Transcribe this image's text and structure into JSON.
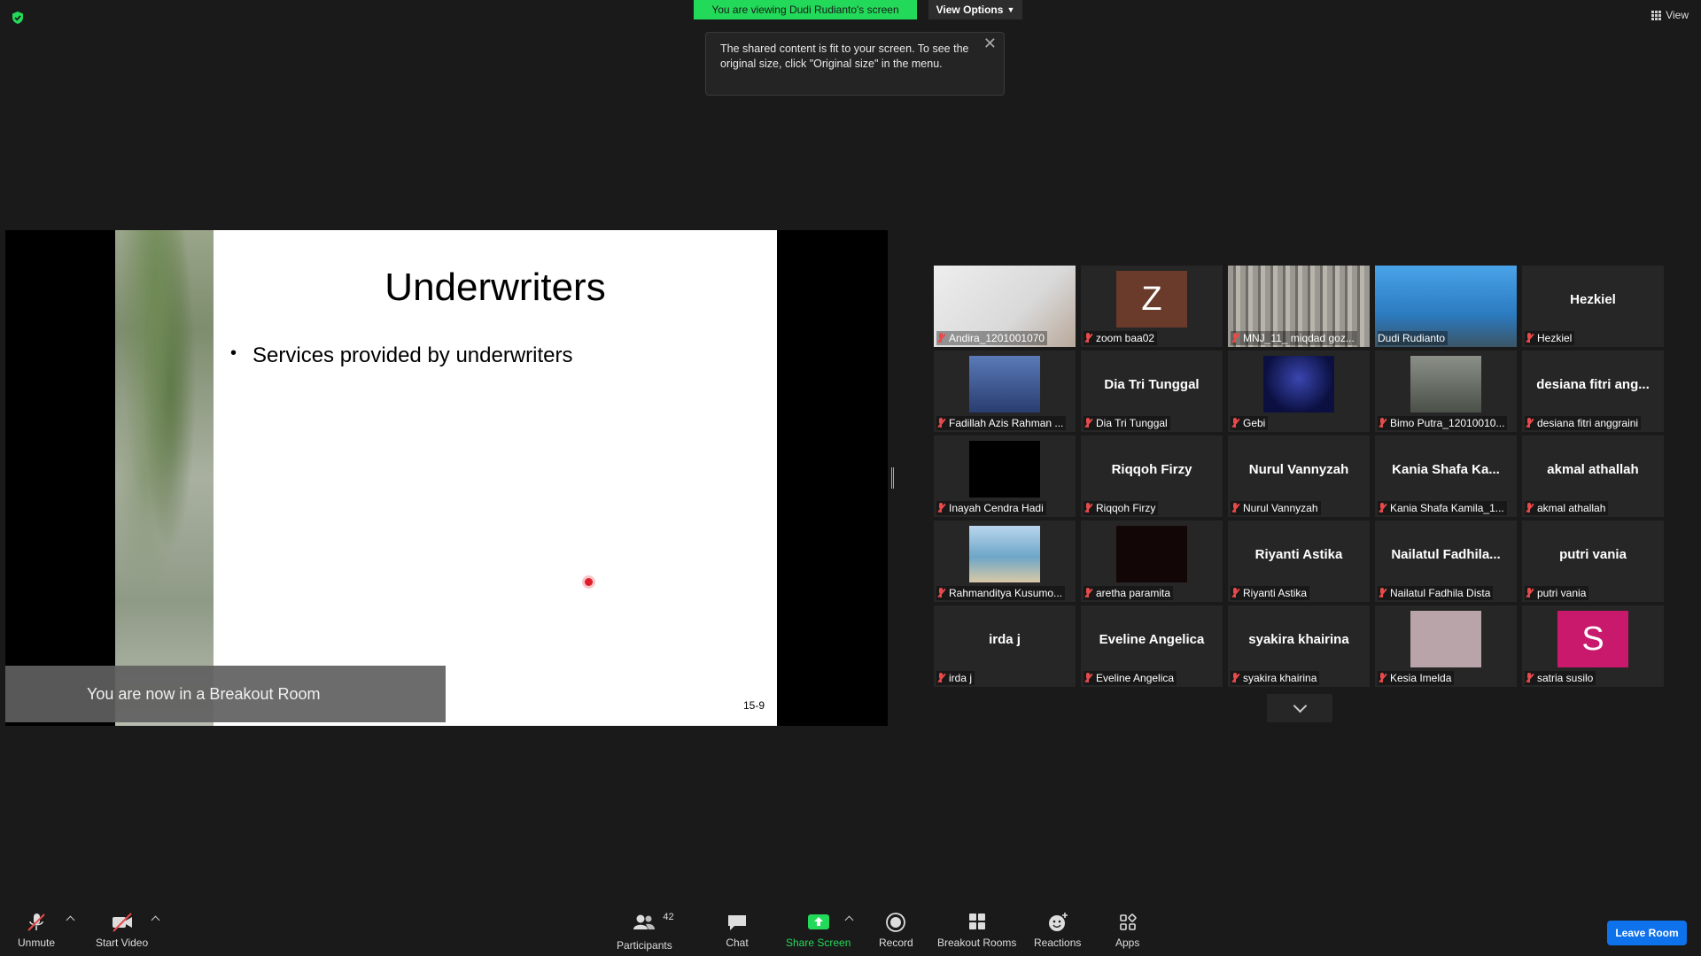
{
  "banner": {
    "viewing_text": "You are viewing Dudi Rudianto's screen",
    "view_options_label": "View Options",
    "tooltip_text": "The shared content is fit to your screen. To see the original size, click \"Original size\" in the menu.",
    "view_label": "View"
  },
  "slide": {
    "title": "Underwriters",
    "bullet": "Services provided by underwriters",
    "page_number": "15-9"
  },
  "breakout_message": "You are now in a Breakout Room",
  "gallery": {
    "tiles": [
      {
        "name": "Andira_1201001070",
        "big_name": "",
        "kind": "photo"
      },
      {
        "name": "zoom baa02",
        "big_name": "",
        "kind": "letter",
        "letter": "Z",
        "color": "#6a3a2a"
      },
      {
        "name": "MNJ_11_ miqdad goz...",
        "big_name": "",
        "kind": "photo"
      },
      {
        "name": "Dudi Rudianto",
        "big_name": "",
        "kind": "video",
        "active": true
      },
      {
        "name": "Hezkiel",
        "big_name": "Hezkiel",
        "kind": "name"
      },
      {
        "name": "Fadillah Azis Rahman ...",
        "big_name": "",
        "kind": "photo"
      },
      {
        "name": "Dia Tri Tunggal",
        "big_name": "Dia Tri Tunggal",
        "kind": "name"
      },
      {
        "name": "Gebi",
        "big_name": "",
        "kind": "photo"
      },
      {
        "name": "Bimo Putra_12010010...",
        "big_name": "",
        "kind": "photo"
      },
      {
        "name": "desiana fitri anggraini",
        "big_name": "desiana fitri ang...",
        "kind": "name"
      },
      {
        "name": "Inayah Cendra Hadi",
        "big_name": "",
        "kind": "photo"
      },
      {
        "name": "Riqqoh Firzy",
        "big_name": "Riqqoh Firzy",
        "kind": "name"
      },
      {
        "name": "Nurul Vannyzah",
        "big_name": "Nurul Vannyzah",
        "kind": "name"
      },
      {
        "name": "Kania Shafa Kamila_1...",
        "big_name": "Kania Shafa Ka...",
        "kind": "name"
      },
      {
        "name": "akmal athallah",
        "big_name": "akmal athallah",
        "kind": "name"
      },
      {
        "name": "Rahmanditya Kusumo...",
        "big_name": "",
        "kind": "photo"
      },
      {
        "name": "aretha paramita",
        "big_name": "",
        "kind": "photo"
      },
      {
        "name": "Riyanti Astika",
        "big_name": "Riyanti Astika",
        "kind": "name"
      },
      {
        "name": "Nailatul Fadhila Dista",
        "big_name": "Nailatul Fadhila...",
        "kind": "name"
      },
      {
        "name": "putri vania",
        "big_name": "putri vania",
        "kind": "name"
      },
      {
        "name": "irda j",
        "big_name": "irda j",
        "kind": "name"
      },
      {
        "name": "Eveline Angelica",
        "big_name": "Eveline Angelica",
        "kind": "name"
      },
      {
        "name": "syakira khairina",
        "big_name": "syakira khairina",
        "kind": "name"
      },
      {
        "name": "Kesia Imelda",
        "big_name": "",
        "kind": "photo"
      },
      {
        "name": "satria susilo",
        "big_name": "",
        "kind": "letter",
        "letter": "S",
        "color": "#c8196c"
      }
    ]
  },
  "toolbar": {
    "unmute": "Unmute",
    "start_video": "Start Video",
    "participants": "Participants",
    "participants_count": "42",
    "chat": "Chat",
    "share_screen": "Share Screen",
    "record": "Record",
    "breakout_rooms": "Breakout Rooms",
    "reactions": "Reactions",
    "apps": "Apps",
    "leave_room": "Leave Room"
  },
  "colors": {
    "share_green": "#23d959",
    "leave_blue": "#0e72ed",
    "active_speaker": "#f4e23a",
    "muted_red": "#e84a4a"
  }
}
